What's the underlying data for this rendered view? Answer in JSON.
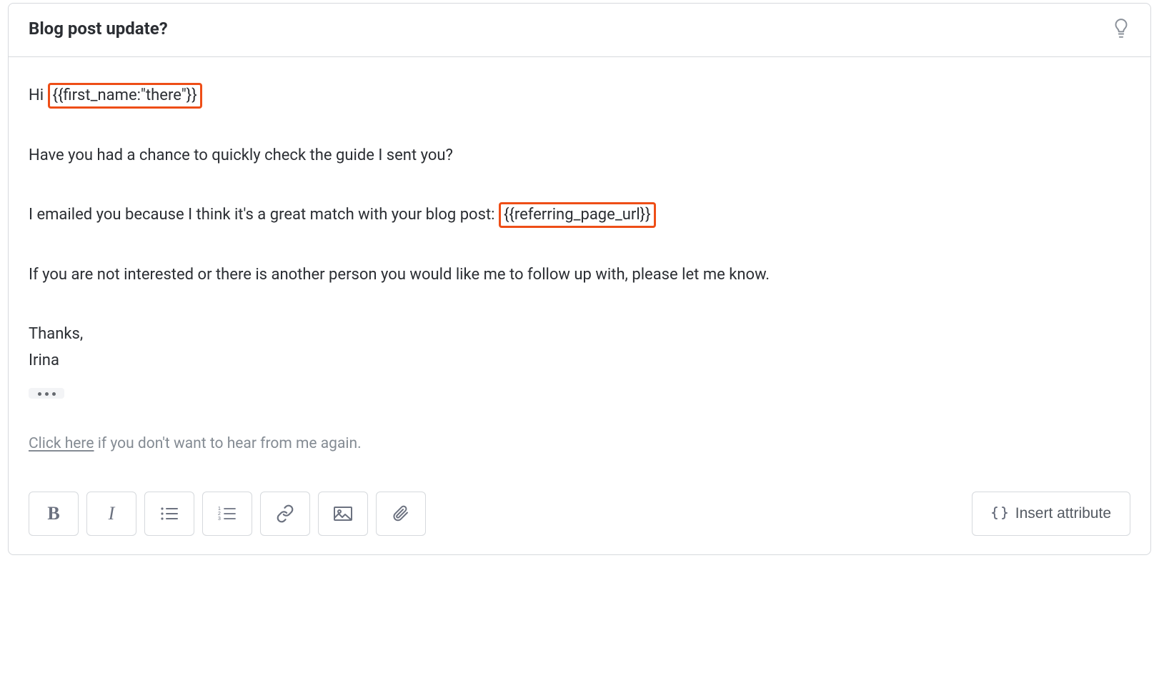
{
  "composer": {
    "subject": "Blog post update?"
  },
  "body": {
    "greeting_prefix": "Hi ",
    "greeting_token": "{{first_name:\"there\"}}",
    "para1": "Have you had a chance to quickly check the guide I sent you?",
    "para2_prefix": "I emailed you because I think it's a great match with your blog post: ",
    "para2_token": "{{referring_page_url}}",
    "para3": "If you are not interested or there is another person you would like me to follow up with, please let me know.",
    "signoff": "Thanks,",
    "signature": "Irina",
    "optout_link": "Click here",
    "optout_text": " if you don't want to hear from me again."
  },
  "toolbar": {
    "insert_attribute_label": "Insert attribute"
  }
}
